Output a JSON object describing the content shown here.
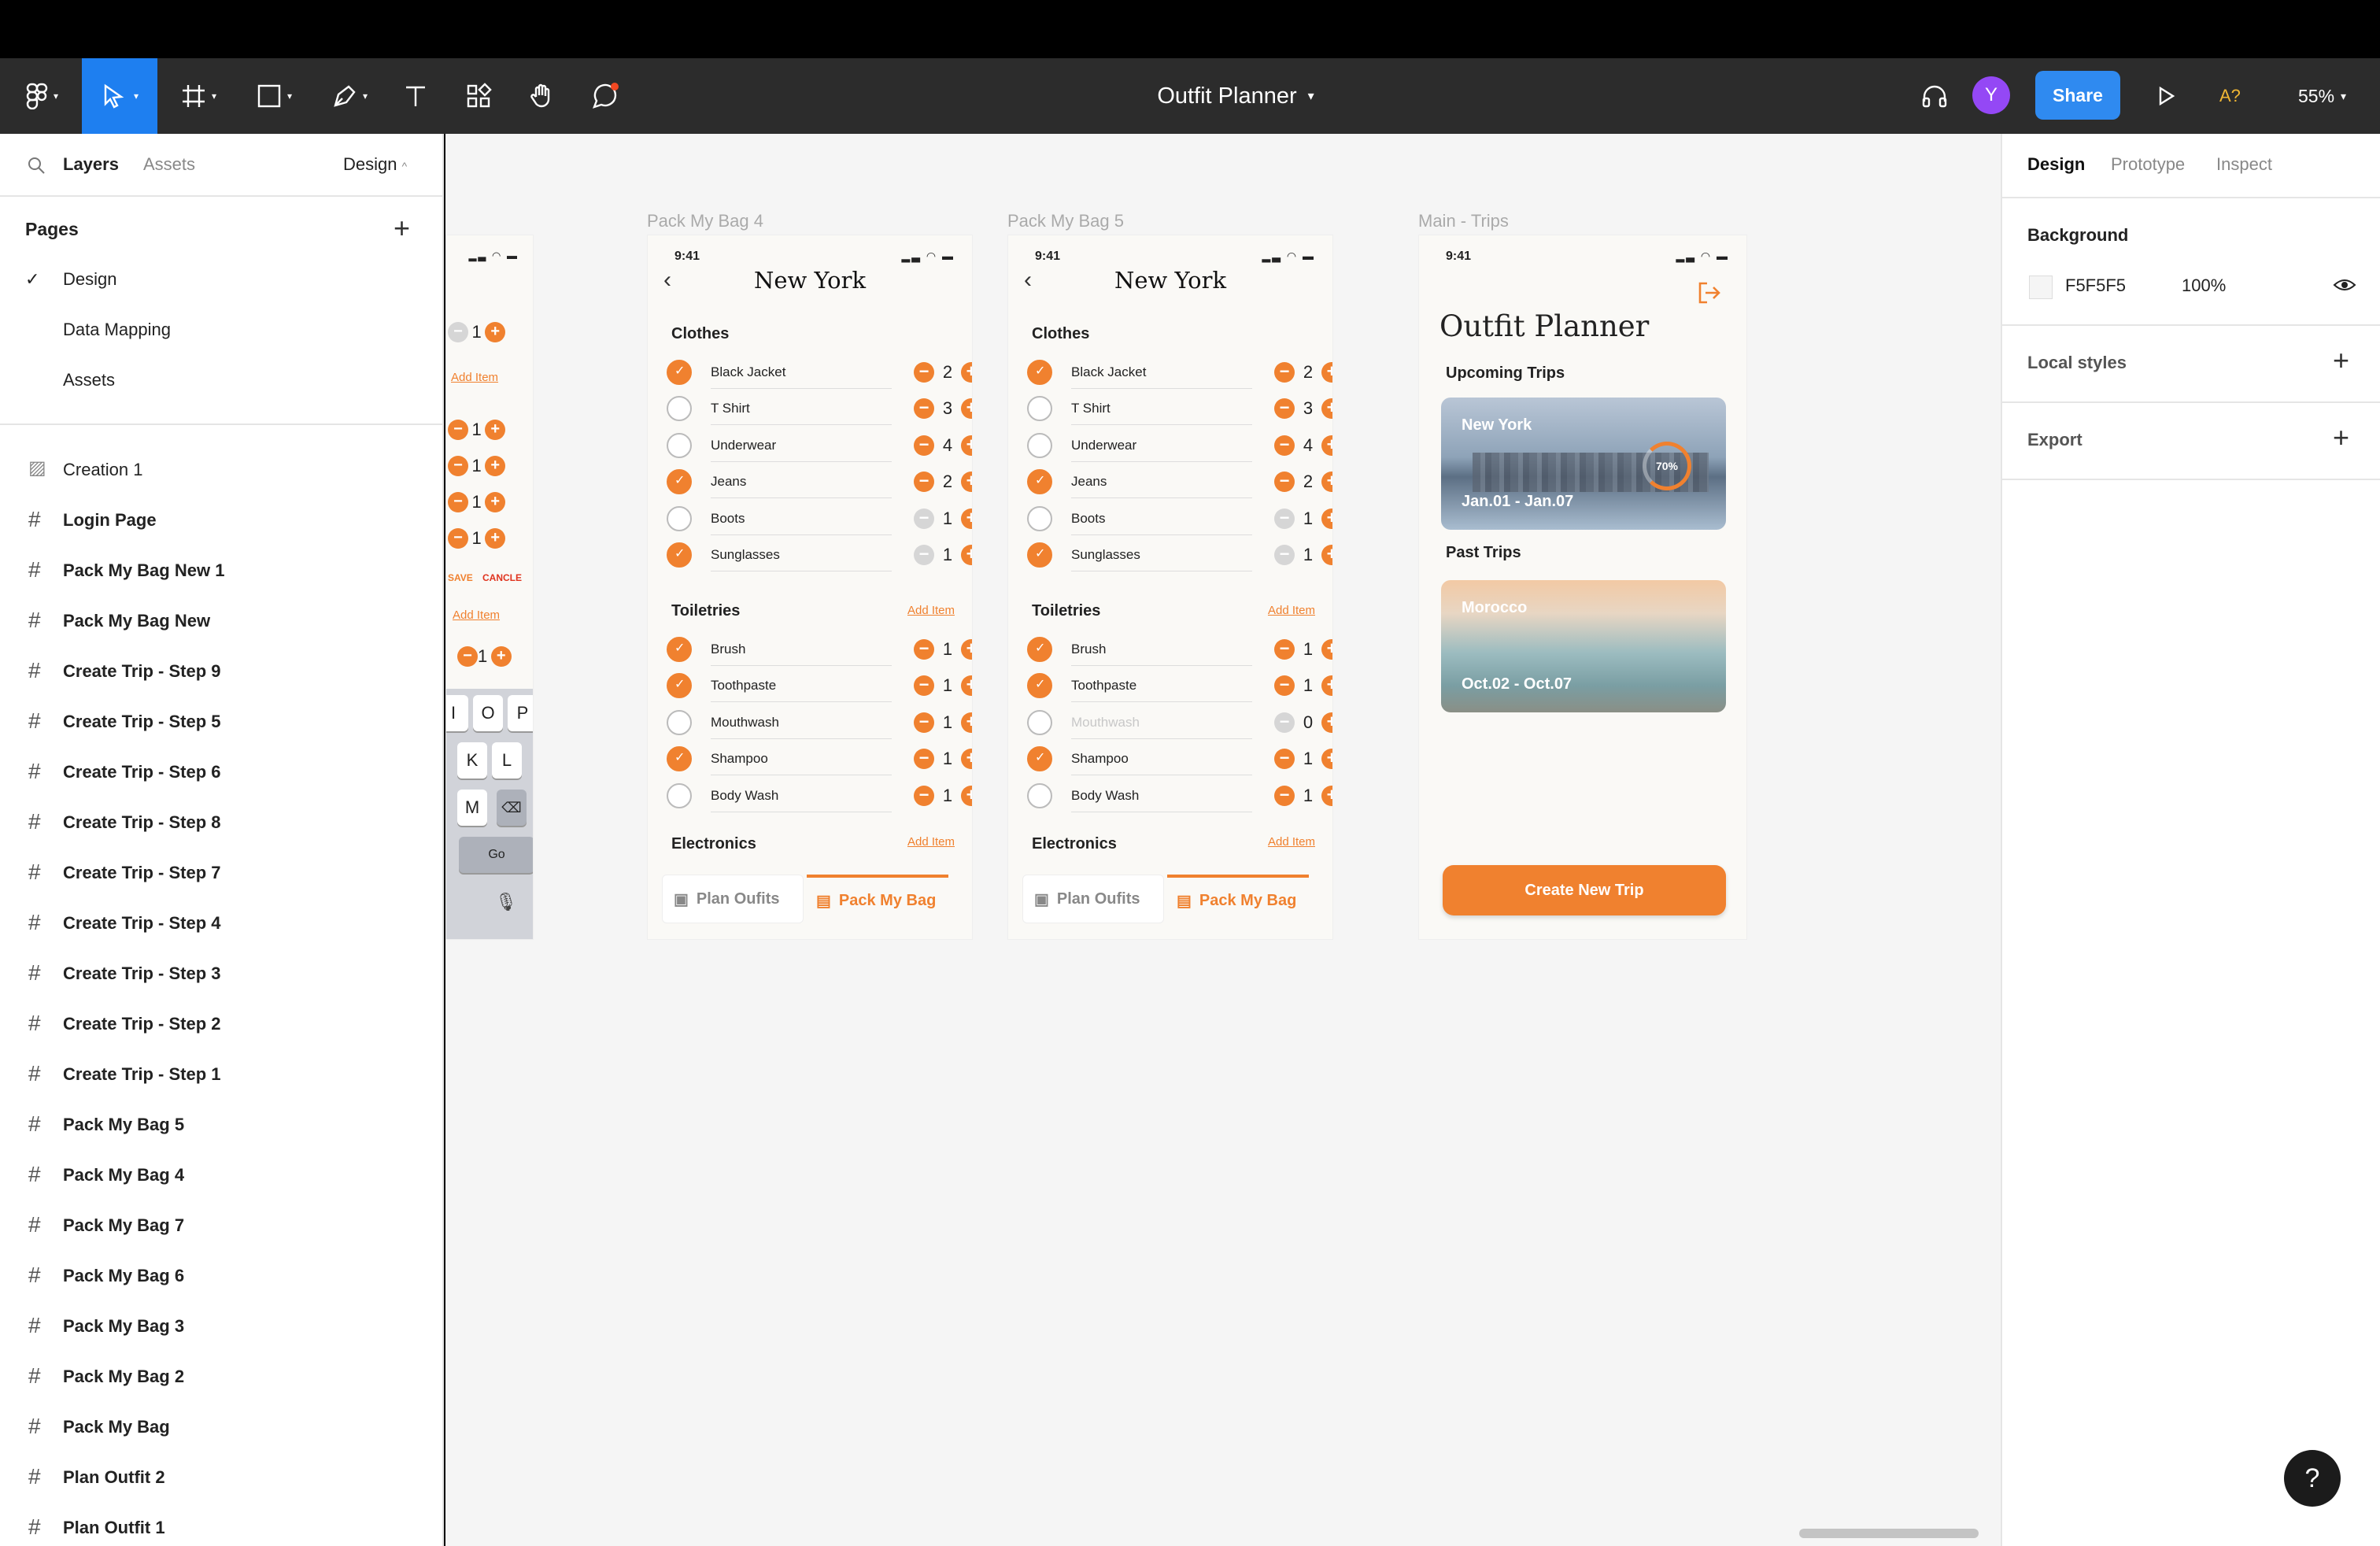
{
  "toolbar": {
    "doc_title": "Outfit Planner",
    "share_label": "Share",
    "avatar_initial": "Y",
    "amber_label": "A?",
    "zoom_label": "55%"
  },
  "left_panel": {
    "tabs": {
      "layers": "Layers",
      "assets": "Assets",
      "page_menu": "Design"
    },
    "pages_title": "Pages",
    "pages": [
      {
        "label": "Design",
        "current": true
      },
      {
        "label": "Data Mapping",
        "current": false
      },
      {
        "label": "Assets",
        "current": false
      }
    ],
    "layers": [
      "Creation 1",
      "Login Page",
      "Pack My Bag New 1",
      "Pack My Bag New",
      "Create Trip - Step 9",
      "Create Trip - Step 5",
      "Create Trip - Step 6",
      "Create Trip - Step 8",
      "Create Trip - Step 7",
      "Create Trip - Step 4",
      "Create Trip - Step 3",
      "Create Trip - Step 2",
      "Create Trip - Step 1",
      "Pack My Bag 5",
      "Pack My Bag 4",
      "Pack My Bag 7",
      "Pack My Bag 6",
      "Pack My Bag 3",
      "Pack My Bag 2",
      "Pack My Bag",
      "Plan Outfit 2",
      "Plan Outfit 1"
    ]
  },
  "canvas": {
    "partial_frame": {
      "qtys": [
        "1",
        "1",
        "1",
        "1",
        "1"
      ],
      "add_item": "Add Item",
      "save": "SAVE",
      "cancel": "CANCLE",
      "go": "Go",
      "last_qty": "1",
      "keys_row1": [
        "I",
        "O",
        "P"
      ],
      "keys_row2": [
        "K",
        "L"
      ],
      "keys_row3": [
        "M"
      ]
    },
    "frames": [
      {
        "label": "Pack My Bag 4",
        "time": "9:41",
        "title": "New York",
        "clothes_title": "Clothes",
        "clothes": [
          {
            "name": "Black Jacket",
            "checked": true,
            "qty": "2",
            "minus_active": true,
            "dim": false
          },
          {
            "name": "T Shirt",
            "checked": false,
            "qty": "3",
            "minus_active": true,
            "dim": false
          },
          {
            "name": "Underwear",
            "checked": false,
            "qty": "4",
            "minus_active": true,
            "dim": false
          },
          {
            "name": "Jeans",
            "checked": true,
            "qty": "2",
            "minus_active": true,
            "dim": false
          },
          {
            "name": "Boots",
            "checked": false,
            "qty": "1",
            "minus_active": false,
            "dim": false
          },
          {
            "name": "Sunglasses",
            "checked": true,
            "qty": "1",
            "minus_active": false,
            "dim": false
          }
        ],
        "toiletries_title": "Toiletries",
        "add_item": "Add Item",
        "toiletries": [
          {
            "name": "Brush",
            "checked": true,
            "qty": "1",
            "minus_active": true,
            "dim": false
          },
          {
            "name": "Toothpaste",
            "checked": true,
            "qty": "1",
            "minus_active": true,
            "dim": false
          },
          {
            "name": "Mouthwash",
            "checked": false,
            "qty": "1",
            "minus_active": true,
            "dim": false
          },
          {
            "name": "Shampoo",
            "checked": true,
            "qty": "1",
            "minus_active": true,
            "dim": false
          },
          {
            "name": "Body Wash",
            "checked": false,
            "qty": "1",
            "minus_active": true,
            "dim": false
          }
        ],
        "electronics_title": "Electronics",
        "tab_plan": "Plan Oufits",
        "tab_pack": "Pack My Bag"
      },
      {
        "label": "Pack My Bag 5",
        "time": "9:41",
        "title": "New York",
        "clothes_title": "Clothes",
        "clothes": [
          {
            "name": "Black Jacket",
            "checked": true,
            "qty": "2",
            "minus_active": true,
            "dim": false
          },
          {
            "name": "T Shirt",
            "checked": false,
            "qty": "3",
            "minus_active": true,
            "dim": false
          },
          {
            "name": "Underwear",
            "checked": false,
            "qty": "4",
            "minus_active": true,
            "dim": false
          },
          {
            "name": "Jeans",
            "checked": true,
            "qty": "2",
            "minus_active": true,
            "dim": false
          },
          {
            "name": "Boots",
            "checked": false,
            "qty": "1",
            "minus_active": false,
            "dim": false
          },
          {
            "name": "Sunglasses",
            "checked": true,
            "qty": "1",
            "minus_active": false,
            "dim": false
          }
        ],
        "toiletries_title": "Toiletries",
        "add_item": "Add Item",
        "toiletries": [
          {
            "name": "Brush",
            "checked": true,
            "qty": "1",
            "minus_active": true,
            "dim": false
          },
          {
            "name": "Toothpaste",
            "checked": true,
            "qty": "1",
            "minus_active": true,
            "dim": false
          },
          {
            "name": "Mouthwash",
            "checked": false,
            "qty": "0",
            "minus_active": false,
            "dim": true
          },
          {
            "name": "Shampoo",
            "checked": true,
            "qty": "1",
            "minus_active": true,
            "dim": false
          },
          {
            "name": "Body Wash",
            "checked": false,
            "qty": "1",
            "minus_active": true,
            "dim": false
          }
        ],
        "electronics_title": "Electronics",
        "tab_plan": "Plan Oufits",
        "tab_pack": "Pack My Bag"
      }
    ],
    "main_trips": {
      "label": "Main - Trips",
      "time": "9:41",
      "title": "Outfit Planner",
      "upcoming_title": "Upcoming Trips",
      "upcoming": {
        "name": "New York",
        "dates": "Jan.01 - Jan.07",
        "progress": "70%"
      },
      "past_title": "Past Trips",
      "past": {
        "name": "Morocco",
        "dates": "Oct.02 - Oct.07"
      },
      "create_button": "Create New Trip"
    }
  },
  "right_panel": {
    "tabs": [
      "Design",
      "Prototype",
      "Inspect"
    ],
    "background_title": "Background",
    "bg_hex": "F5F5F5",
    "bg_opacity": "100%",
    "local_styles": "Local styles",
    "export": "Export"
  },
  "colors": {
    "accent": "#f0812f",
    "share_blue": "#2f8af0",
    "avatar": "#9448f5",
    "canvas_bg": "#f5f5f5"
  }
}
